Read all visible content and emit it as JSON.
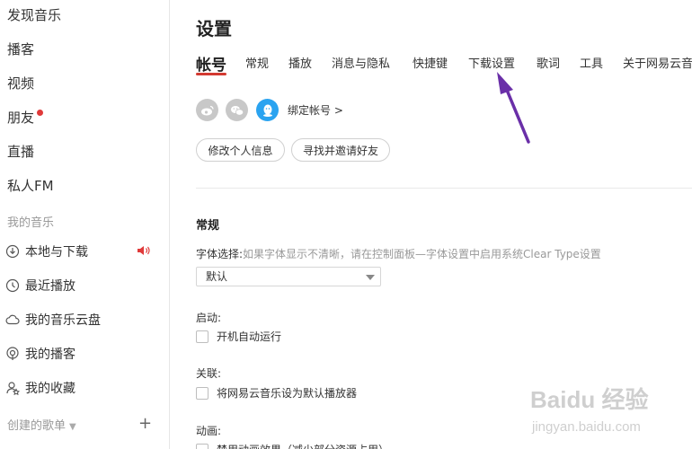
{
  "sidebar": {
    "top_items": [
      {
        "label": "发现音乐"
      },
      {
        "label": "播客"
      },
      {
        "label": "视频"
      },
      {
        "label": "朋友"
      },
      {
        "label": "直播"
      },
      {
        "label": "私人FM"
      }
    ],
    "my_music_title": "我的音乐",
    "library": [
      {
        "label": "本地与下载",
        "icon": "download-icon"
      },
      {
        "label": "最近播放",
        "icon": "clock-icon"
      },
      {
        "label": "我的音乐云盘",
        "icon": "cloud-icon"
      },
      {
        "label": "我的播客",
        "icon": "podcast-icon"
      },
      {
        "label": "我的收藏",
        "icon": "collection-icon"
      }
    ],
    "created_playlists_title": "创建的歌单"
  },
  "main": {
    "title": "设置",
    "tabs": [
      {
        "label": "帐号"
      },
      {
        "label": "常规"
      },
      {
        "label": "播放"
      },
      {
        "label": "消息与隐私"
      },
      {
        "label": "快捷键"
      },
      {
        "label": "下载设置"
      },
      {
        "label": "歌词"
      },
      {
        "label": "工具"
      },
      {
        "label": "关于网易云音乐"
      }
    ],
    "account": {
      "bind_label": "绑定帐号 >",
      "edit_profile": "修改个人信息",
      "find_friends": "寻找并邀请好友"
    },
    "general": {
      "heading": "常规",
      "font_label": "字体选择:",
      "font_hint": "如果字体显示不清晰，请在控制面板—字体设置中启用系统Clear Type设置",
      "font_value": "默认",
      "startup_label": "启动:",
      "startup_option": "开机自动运行",
      "assoc_label": "关联:",
      "assoc_option": "将网易云音乐设为默认播放器",
      "anim_label": "动画:",
      "anim_option": "禁用动画效果（减少部分资源占用）"
    }
  },
  "watermark": {
    "text": "Baidu 经验",
    "sub": "jingyan.baidu.com"
  },
  "colors": {
    "accent": "#d33a31",
    "pointer": "#6a2fa8",
    "qq": "#2aa3f0"
  }
}
